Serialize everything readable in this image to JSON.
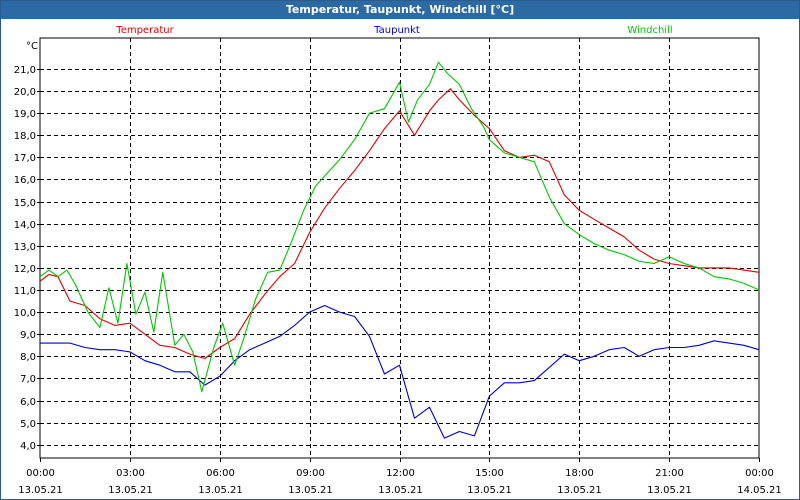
{
  "window": {
    "title": "Temperatur, Taupunkt, Windchill [°C]"
  },
  "chart_data": {
    "type": "line",
    "title": "Temperatur, Taupunkt, Windchill [°C]",
    "ylabel": "°C",
    "ylim": [
      3.4,
      22.4
    ],
    "yticks": [
      4.0,
      5.0,
      6.0,
      7.0,
      8.0,
      9.0,
      10.0,
      11.0,
      12.0,
      13.0,
      14.0,
      15.0,
      16.0,
      17.0,
      18.0,
      19.0,
      20.0,
      21.0
    ],
    "ytick_labels": [
      "4,0",
      "5,0",
      "6,0",
      "7,0",
      "8,0",
      "9,0",
      "10,0",
      "11,0",
      "12,0",
      "13,0",
      "14,0",
      "15,0",
      "16,0",
      "17,0",
      "18,0",
      "19,0",
      "20,0",
      "21,0"
    ],
    "xlim": [
      0,
      24
    ],
    "xticks": [
      {
        "time": "00:00",
        "date": "13.05.21"
      },
      {
        "time": "03:00",
        "date": "13.05.21"
      },
      {
        "time": "06:00",
        "date": "13.05.21"
      },
      {
        "time": "09:00",
        "date": "13.05.21"
      },
      {
        "time": "12:00",
        "date": "13.05.21"
      },
      {
        "time": "15:00",
        "date": "13.05.21"
      },
      {
        "time": "18:00",
        "date": "13.05.21"
      },
      {
        "time": "21:00",
        "date": "13.05.21"
      },
      {
        "time": "00:00",
        "date": "14.05.21"
      }
    ],
    "grid": true,
    "legend_position": "top",
    "series": [
      {
        "name": "Temperatur",
        "color": "#e00000",
        "x": [
          0,
          0.3,
          0.6,
          1,
          1.5,
          2,
          2.5,
          3,
          3.5,
          4,
          4.5,
          5,
          5.5,
          6,
          6.5,
          7,
          7.5,
          8,
          8.5,
          9,
          9.5,
          10,
          10.5,
          11,
          11.5,
          12,
          12.5,
          13,
          13.3,
          13.7,
          14,
          14.5,
          15,
          15.5,
          16,
          16.5,
          17,
          17.5,
          18,
          18.5,
          19,
          19.5,
          20,
          20.5,
          21,
          21.5,
          22,
          22.5,
          23,
          23.5,
          24
        ],
        "y": [
          11.4,
          11.7,
          11.6,
          10.5,
          10.3,
          9.7,
          9.4,
          9.5,
          9.0,
          8.5,
          8.4,
          8.1,
          7.9,
          8.4,
          8.8,
          9.9,
          10.8,
          11.6,
          12.2,
          13.6,
          14.7,
          15.6,
          16.4,
          17.3,
          18.3,
          19.1,
          18.0,
          19.1,
          19.6,
          20.1,
          19.6,
          18.9,
          18.3,
          17.3,
          17.0,
          17.1,
          16.8,
          15.3,
          14.6,
          14.2,
          13.8,
          13.4,
          12.8,
          12.4,
          12.2,
          12.1,
          12.0,
          12.0,
          12.0,
          11.9,
          11.8
        ]
      },
      {
        "name": "Taupunkt",
        "color": "#0000c8",
        "x": [
          0,
          0.5,
          1,
          1.5,
          2,
          2.5,
          3,
          3.5,
          4,
          4.5,
          5,
          5.5,
          6,
          6.5,
          7,
          7.5,
          8,
          8.5,
          9,
          9.5,
          10,
          10.5,
          11,
          11.5,
          12,
          12.5,
          13,
          13.5,
          14,
          14.5,
          15,
          15.5,
          16,
          16.5,
          17,
          17.5,
          18,
          18.5,
          19,
          19.5,
          20,
          20.5,
          21,
          21.5,
          22,
          22.5,
          23,
          23.5,
          24
        ],
        "y": [
          8.6,
          8.6,
          8.6,
          8.4,
          8.3,
          8.3,
          8.2,
          7.8,
          7.6,
          7.3,
          7.3,
          6.7,
          7.1,
          7.8,
          8.3,
          8.6,
          8.9,
          9.4,
          10.0,
          10.3,
          10.0,
          9.8,
          8.9,
          7.2,
          7.6,
          5.2,
          5.7,
          4.3,
          4.6,
          4.4,
          6.2,
          6.8,
          6.8,
          6.9,
          7.5,
          8.1,
          7.8,
          8.0,
          8.3,
          8.4,
          8.0,
          8.3,
          8.4,
          8.4,
          8.5,
          8.7,
          8.6,
          8.5,
          8.3
        ]
      },
      {
        "name": "Windchill",
        "color": "#00c800",
        "x": [
          0,
          0.3,
          0.6,
          0.9,
          1.2,
          1.6,
          2.0,
          2.3,
          2.6,
          2.9,
          3.2,
          3.5,
          3.8,
          4.1,
          4.5,
          4.8,
          5.1,
          5.4,
          5.8,
          6.1,
          6.5,
          6.8,
          7.2,
          7.6,
          8.0,
          8.4,
          8.8,
          9.2,
          9.6,
          10.0,
          10.5,
          11.0,
          11.5,
          12.0,
          12.3,
          12.6,
          13.0,
          13.3,
          13.6,
          14.0,
          14.4,
          14.8,
          15.0,
          15.5,
          16.0,
          16.5,
          17.0,
          17.5,
          18.0,
          18.5,
          19.0,
          19.5,
          20.0,
          20.5,
          21.0,
          21.5,
          22.0,
          22.5,
          23.0,
          23.5,
          24.0
        ],
        "y": [
          11.6,
          11.9,
          11.6,
          11.9,
          11.2,
          10.0,
          9.3,
          11.1,
          9.5,
          12.2,
          9.9,
          10.9,
          9.1,
          11.8,
          8.5,
          9.0,
          8.2,
          6.4,
          8.4,
          9.5,
          7.6,
          8.8,
          10.6,
          11.8,
          11.9,
          13.2,
          14.6,
          15.7,
          16.3,
          16.9,
          17.8,
          19.0,
          19.2,
          20.4,
          18.6,
          19.6,
          20.3,
          21.3,
          20.8,
          20.3,
          19.2,
          18.4,
          17.8,
          17.2,
          17.0,
          16.8,
          15.2,
          14.0,
          13.5,
          13.1,
          12.8,
          12.6,
          12.3,
          12.2,
          12.5,
          12.2,
          12.0,
          11.6,
          11.5,
          11.3,
          11.0
        ]
      }
    ]
  }
}
